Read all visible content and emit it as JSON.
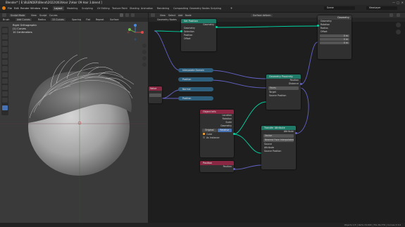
{
  "window": {
    "title": "Blender* [ E:\\BLENDER\\Blend\\2022\\003\\Hair 2\\Hair 09 Hair 3.blend ]"
  },
  "menubar": {
    "items": [
      "File",
      "Edit",
      "Render",
      "Window",
      "Help"
    ],
    "workspaces": [
      "Layout",
      "Modeling",
      "Sculpting",
      "UV Editing",
      "Texture Paint",
      "Shading",
      "Animation",
      "Rendering",
      "Compositing",
      "Geometry Nodes",
      "Scripting"
    ],
    "active_workspace": "Layout",
    "scene": "Scene",
    "view_layer": "ViewLayer"
  },
  "viewport": {
    "mode": "Sculpt Mode",
    "menus": [
      "View",
      "Sculpt",
      "Curves"
    ],
    "header2": [
      "Brush",
      "Add Curves",
      "Radius",
      "15 Curves",
      "Spacing",
      "Flat",
      "Repeat",
      "Surface"
    ],
    "info": [
      "Right Orthographic",
      "(1) Curves",
      "10 Centimeters"
    ],
    "gizmo": {
      "x": "X",
      "y": "Y",
      "z": "Z"
    }
  },
  "node_editor": {
    "menus": [
      "View",
      "Select",
      "Add",
      "Node"
    ],
    "tree_name": "Surface deform",
    "breadcrumb": "Geometry Nodes",
    "nodes": {
      "setpos": {
        "title": "Set Position",
        "outputs": [
          "Geometry"
        ],
        "inputs": [
          "Geometry",
          "Selection",
          "Position",
          "Offset"
        ]
      },
      "groupout": {
        "title": "Geometry",
        "inputs": [
          "Geometry",
          "Rotation",
          "Radius",
          "Offset"
        ],
        "values": [
          "0 m",
          "0 m",
          "0 m"
        ]
      },
      "reroutes": [
        "Interpolate Domain",
        "Position",
        "Normal",
        "Position"
      ],
      "valuenode": {
        "title": "Value"
      },
      "geoprox": {
        "title": "Geometry Proximity",
        "outputs": [
          "Position",
          "Distance"
        ],
        "mode": "Faces",
        "inputs": [
          "Target",
          "Source Position"
        ]
      },
      "objinfo": {
        "title": "Object Info",
        "outputs": [
          "Location",
          "Rotation",
          "Scale",
          "Geometry"
        ],
        "toggle": [
          "Original",
          "Relative"
        ],
        "object": "Cube",
        "as_instance": "As Instance"
      },
      "transfer": {
        "title": "Transfer Attribute",
        "output": "Attribute",
        "type": "Vector",
        "mapping": "Nearest Face Interpolated",
        "inputs": [
          "Source",
          "Attribute",
          "Source Position"
        ]
      },
      "position": {
        "title": "Position",
        "output": "Position"
      }
    }
  },
  "statusbar": {
    "text": "Objects 1/3 | Verts 24,690 | Tris 49,376 | Curves 3.3.0"
  },
  "colors": {
    "geometry_link": "#00d6a3",
    "vector_link": "#6363c7",
    "accent": "#4772b3"
  }
}
